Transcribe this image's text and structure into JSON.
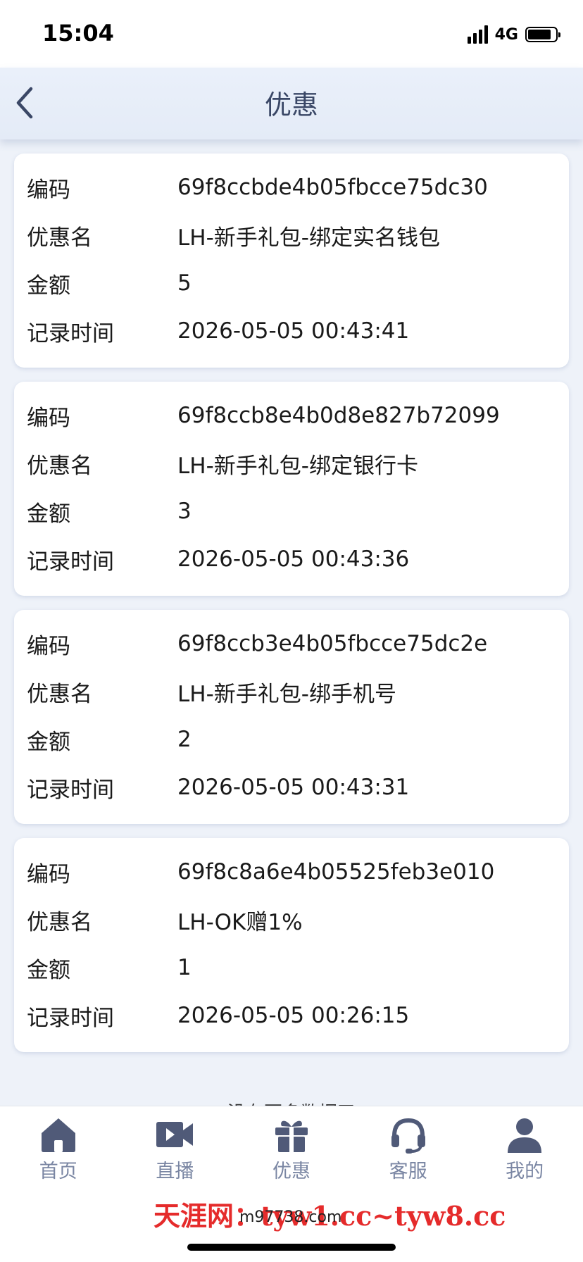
{
  "status_bar": {
    "time": "15:04",
    "network": "4G"
  },
  "header": {
    "title": "优惠"
  },
  "labels": {
    "code": "编码",
    "name": "优惠名",
    "amount": "金额",
    "time": "记录时间"
  },
  "records": [
    {
      "code": "69f8ccbde4b05fbcce75dc30",
      "name": "LH-新手礼包-绑定实名钱包",
      "amount": "5",
      "time": "2026-05-05 00:43:41"
    },
    {
      "code": "69f8ccb8e4b0d8e827b72099",
      "name": "LH-新手礼包-绑定银行卡",
      "amount": "3",
      "time": "2026-05-05 00:43:36"
    },
    {
      "code": "69f8ccb3e4b05fbcce75dc2e",
      "name": "LH-新手礼包-绑手机号",
      "amount": "2",
      "time": "2026-05-05 00:43:31"
    },
    {
      "code": "69f8c8a6e4b05525feb3e010",
      "name": "LH-OK赠1%",
      "amount": "1",
      "time": "2026-05-05 00:26:15"
    }
  ],
  "footer": {
    "no_more": "没有更多数据了"
  },
  "tabs": [
    {
      "label": "首页",
      "icon": "home-icon"
    },
    {
      "label": "直播",
      "icon": "video-icon"
    },
    {
      "label": "优惠",
      "icon": "gift-icon"
    },
    {
      "label": "客服",
      "icon": "headset-icon"
    },
    {
      "label": "我的",
      "icon": "user-icon"
    }
  ],
  "watermark": {
    "red_text": "天涯网：tyw1.cc~tyw8.cc",
    "black_text": "m97738.com"
  },
  "colors": {
    "tab_icon": "#505a78",
    "tab_label": "#7a86a3",
    "watermark_red": "#e52b2b"
  }
}
